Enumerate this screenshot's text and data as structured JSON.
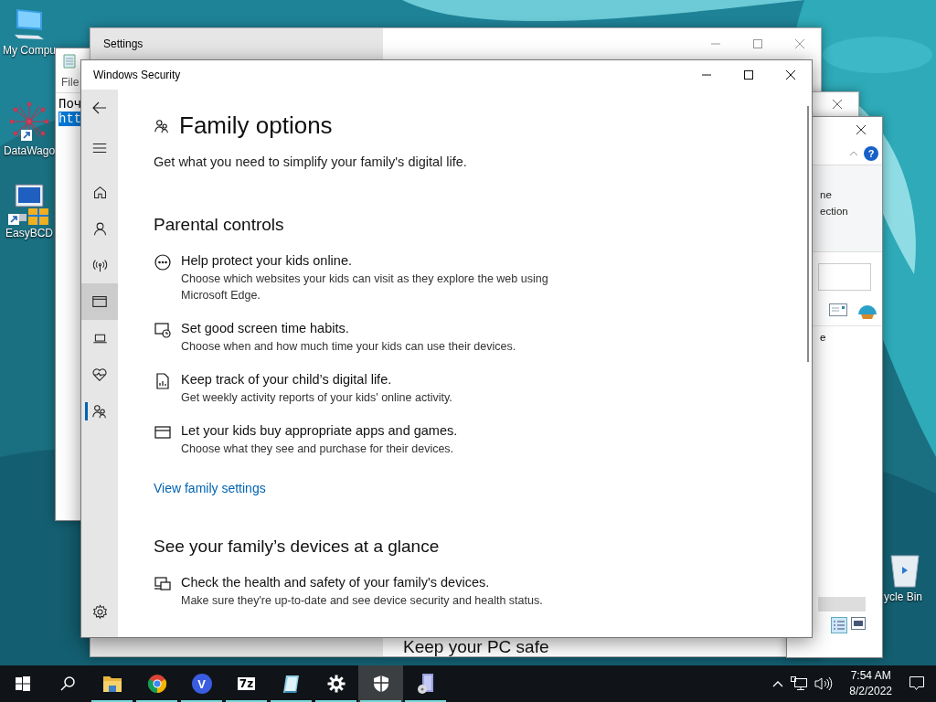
{
  "desktop_icons": [
    {
      "label": "My Compu",
      "kind": "computer"
    },
    {
      "label": "DataWago",
      "kind": "network"
    },
    {
      "label": "EasyBCD",
      "kind": "easybcd"
    }
  ],
  "recycle_bin": {
    "label": "ycle Bin"
  },
  "notepad": {
    "menu": "File",
    "lines": [
      {
        "text": "Поч",
        "selected": false
      },
      {
        "text": "htt",
        "selected": true
      }
    ]
  },
  "settings_window": {
    "title": "Settings",
    "footer_heading": "Keep your PC safe"
  },
  "explorer_window": {
    "help_label": "?",
    "ribbon_texts": [
      "ne",
      "ection"
    ],
    "list_text": "e"
  },
  "security_window": {
    "title": "Windows Security",
    "nav": [
      {
        "kind": "back",
        "selected": false,
        "hovered": false
      },
      {
        "kind": "menu",
        "selected": false,
        "hovered": false
      },
      {
        "kind": "home",
        "selected": false,
        "hovered": false
      },
      {
        "kind": "person",
        "selected": false,
        "hovered": false
      },
      {
        "kind": "wifi",
        "selected": false,
        "hovered": false
      },
      {
        "kind": "browser",
        "selected": false,
        "hovered": true
      },
      {
        "kind": "laptop",
        "selected": false,
        "hovered": false
      },
      {
        "kind": "heart",
        "selected": false,
        "hovered": false
      },
      {
        "kind": "family",
        "selected": true,
        "hovered": false
      }
    ],
    "heading": "Family options",
    "subtitle": "Get what you need to simplify your family's digital life.",
    "sections": [
      {
        "title": "Parental controls",
        "items": [
          {
            "kind": "globe",
            "title": "Help protect your kids online.",
            "description": "Choose which websites your kids can visit as they explore the web using Microsoft Edge."
          },
          {
            "kind": "clock",
            "title": "Set good screen time habits.",
            "description": "Choose when and how much time your kids can use their devices."
          },
          {
            "kind": "report",
            "title": "Keep track of your child’s digital life.",
            "description": "Get weekly activity reports of your kids' online activity."
          },
          {
            "kind": "card",
            "title": "Let your kids buy appropriate apps and games.",
            "description": "Choose what they see and purchase for their devices."
          }
        ],
        "link": "View family settings"
      },
      {
        "title": "See your family’s devices at a glance",
        "items": [
          {
            "kind": "devices",
            "title": "Check the health and safety of your family's devices.",
            "description": "Make sure they're up-to-date and see device security and health status."
          }
        ]
      }
    ]
  },
  "taskbar": {
    "apps": [
      {
        "kind": "start",
        "running": false,
        "active": false
      },
      {
        "kind": "search",
        "running": false,
        "active": false
      },
      {
        "kind": "folder",
        "running": true,
        "active": false
      },
      {
        "kind": "chrome",
        "running": true,
        "active": false
      },
      {
        "kind": "letter",
        "label": "V",
        "running": true,
        "active": false
      },
      {
        "kind": "archive",
        "label": "7z",
        "running": true,
        "active": false
      },
      {
        "kind": "notepad",
        "running": true,
        "active": false
      },
      {
        "kind": "gear",
        "running": true,
        "active": false
      },
      {
        "kind": "shield",
        "running": true,
        "active": true
      },
      {
        "kind": "installer",
        "running": true,
        "active": false
      }
    ],
    "time": "7:54 AM",
    "date": "8/2/2022"
  }
}
